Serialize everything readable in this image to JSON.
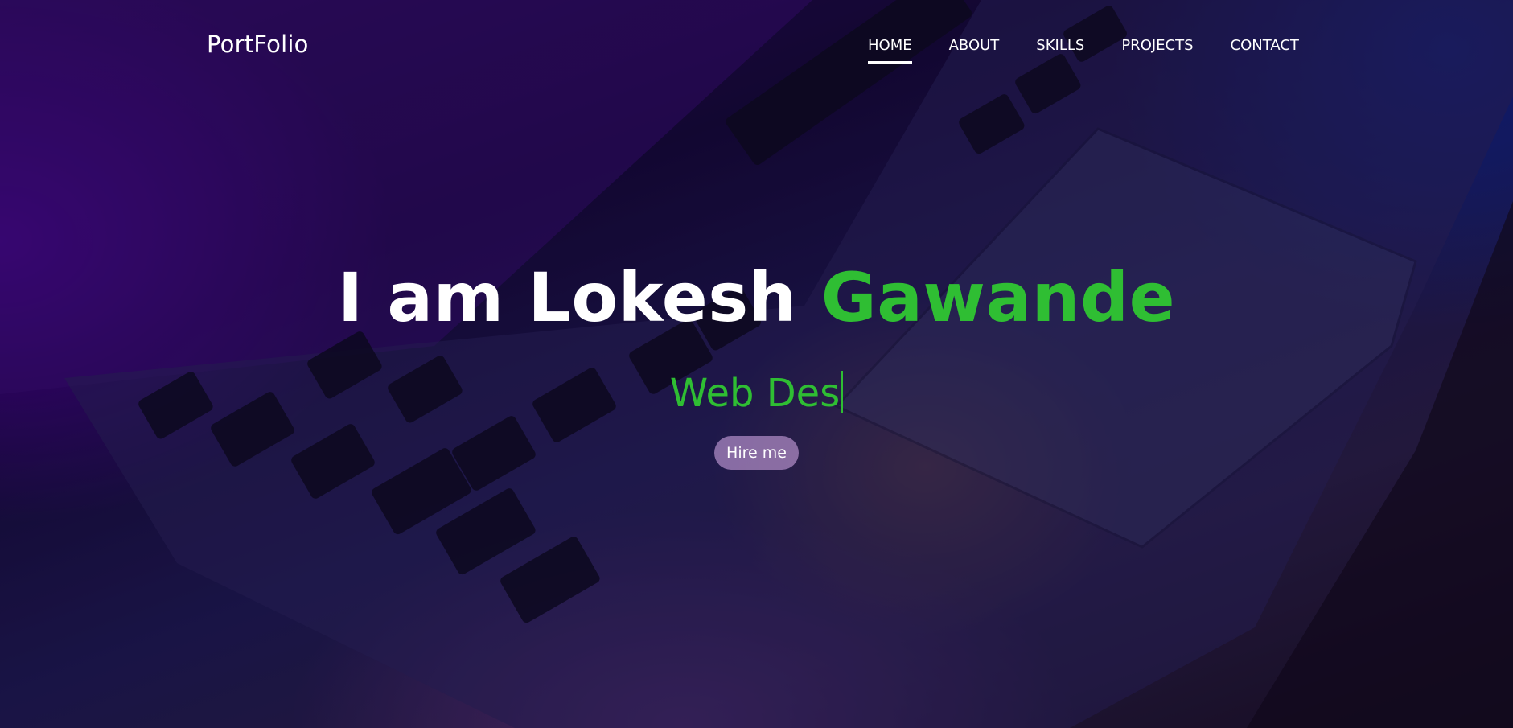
{
  "brand": {
    "logo_text": "PortFolio"
  },
  "nav": {
    "items": [
      {
        "label": "HOME",
        "active": true
      },
      {
        "label": "ABOUT",
        "active": false
      },
      {
        "label": "SKILLS",
        "active": false
      },
      {
        "label": "PROJECTS",
        "active": false
      },
      {
        "label": "CONTACT",
        "active": false
      }
    ]
  },
  "hero": {
    "headline_prefix": "I am Lokesh",
    "headline_accent": "Gawande",
    "typing_text": "Web Des",
    "cta_label": "Hire me"
  },
  "colors": {
    "accent": "#2fbe33",
    "text": "#ffffff"
  }
}
